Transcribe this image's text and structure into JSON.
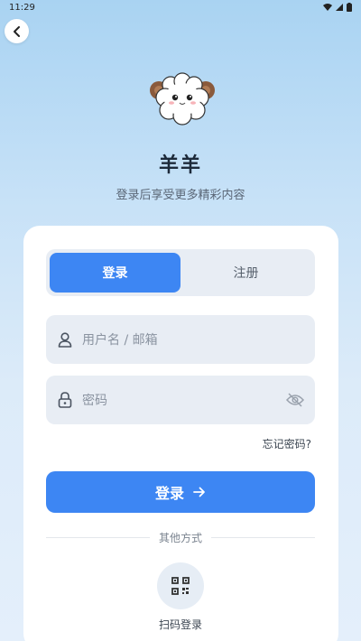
{
  "status_bar": {
    "time": "11:29"
  },
  "header": {
    "app_name": "羊羊",
    "subtitle": "登录后享受更多精彩内容"
  },
  "tabs": [
    {
      "label": "登录",
      "active": true
    },
    {
      "label": "注册",
      "active": false
    }
  ],
  "form": {
    "username_placeholder": "用户名 / 邮箱",
    "password_placeholder": "密码",
    "forgot_label": "忘记密码?",
    "login_label": "登录"
  },
  "other": {
    "divider_label": "其他方式",
    "qr_label": "扫码登录"
  },
  "colors": {
    "accent": "#3d86f3",
    "field_bg": "#e8edf4",
    "card_bg": "#ffffff"
  },
  "icons": [
    "back-icon",
    "user-icon",
    "lock-icon",
    "eye-off-icon",
    "arrow-right-icon",
    "qr-code-icon",
    "wifi-icon",
    "signal-icon",
    "battery-icon"
  ]
}
